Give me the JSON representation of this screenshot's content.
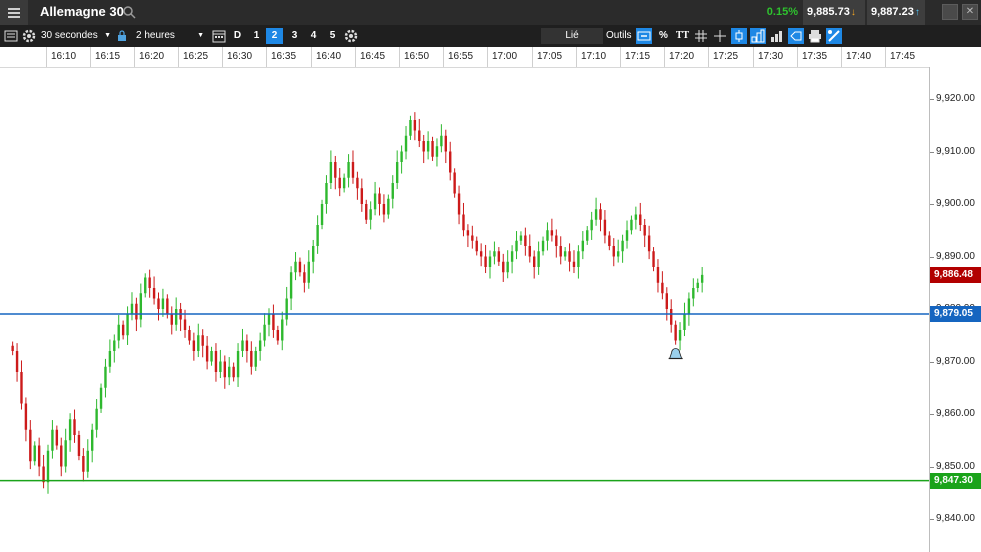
{
  "header": {
    "instrument": "Allemagne 30",
    "change_pct": "0.15%",
    "sell_price": "9,885.73",
    "buy_price": "9,887.23"
  },
  "toolbar": {
    "interval": "30 secondes",
    "range": "2 heures",
    "periods": [
      "D",
      "1",
      "2",
      "3",
      "4",
      "5"
    ],
    "active_period": "2",
    "linked": "Lié",
    "tools": "Outils",
    "percent": "%",
    "text_tool": "TT"
  },
  "time_axis": [
    "16:10",
    "16:15",
    "16:20",
    "16:25",
    "16:30",
    "16:35",
    "16:40",
    "16:45",
    "16:50",
    "16:55",
    "17:00",
    "17:05",
    "17:10",
    "17:15",
    "17:20",
    "17:25",
    "17:30",
    "17:35",
    "17:40",
    "17:45"
  ],
  "price_axis": [
    "9,920.00",
    "9,910.00",
    "9,900.00",
    "9,890.00",
    "9,880.00",
    "9,870.00",
    "9,860.00",
    "9,850.00",
    "9,840.00"
  ],
  "levels": {
    "current": {
      "label": "9,886.48",
      "value": 9886.48,
      "color": "#b20000"
    },
    "blue_line": {
      "label": "9,879.05",
      "value": 9879.05,
      "color": "#1565c0"
    },
    "green_line": {
      "label": "9,847.30",
      "value": 9847.3,
      "color": "#1aa31a"
    }
  },
  "colors": {
    "up": "#2eb82e",
    "down": "#cc1a1a"
  },
  "chart_data": {
    "type": "ohlc",
    "interval": "30 secondes",
    "x_start": "16:06:00",
    "close": [
      9872,
      9868,
      9862,
      9857,
      9851,
      9854,
      9850,
      9847,
      9853,
      9857,
      9854,
      9850,
      9855,
      9859,
      9856,
      9852,
      9849,
      9853,
      9857,
      9861,
      9865,
      9869,
      9872,
      9874,
      9877,
      9875,
      9879,
      9881,
      9878,
      9883,
      9886,
      9884,
      9882,
      9880,
      9882,
      9879,
      9877,
      9880,
      9878,
      9876,
      9874,
      9872,
      9875,
      9873,
      9870,
      9872,
      9868,
      9870,
      9867,
      9869,
      9867,
      9872,
      9874,
      9872,
      9869,
      9872,
      9874,
      9877,
      9879,
      9876,
      9874,
      9878,
      9882,
      9887,
      9889,
      9887,
      9885,
      9889,
      9892,
      9896,
      9900,
      9904,
      9908,
      9905,
      9903,
      9905,
      9908,
      9905,
      9903,
      9900,
      9897,
      9899,
      9902,
      9900,
      9898,
      9901,
      9904,
      9908,
      9910,
      9913,
      9916,
      9914,
      9912,
      9910,
      9912,
      9909,
      9911,
      9913,
      9910,
      9906,
      9902,
      9898,
      9895,
      9894,
      9893,
      9891,
      9890,
      9888,
      9890,
      9891,
      9889,
      9887,
      9889,
      9891,
      9893,
      9894,
      9892,
      9890,
      9888,
      9891,
      9893,
      9895,
      9894,
      9892,
      9890,
      9891,
      9889,
      9888,
      9891,
      9893,
      9895,
      9897,
      9899,
      9897,
      9894,
      9892,
      9890,
      9891,
      9893,
      9895,
      9897,
      9898,
      9896,
      9894,
      9891,
      9888,
      9885,
      9883,
      9880,
      9877,
      9874,
      9876,
      9879,
      9882,
      9884,
      9885,
      9886.5
    ]
  }
}
